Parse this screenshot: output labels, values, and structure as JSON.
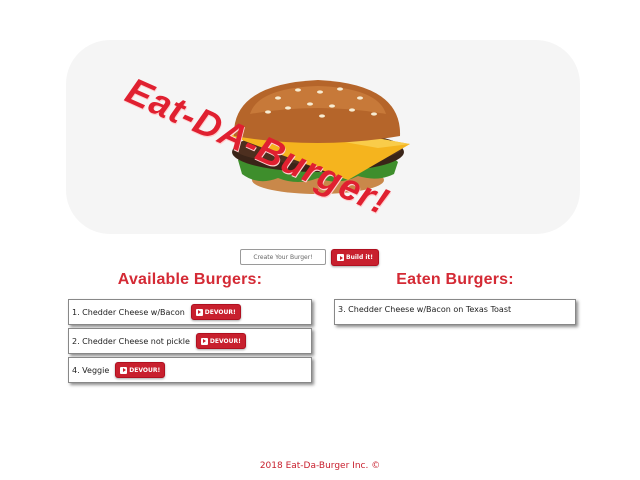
{
  "header": {
    "logo_text": "Eat-DA-Burger!"
  },
  "form": {
    "input_placeholder": "Create Your Burger!",
    "build_label": "Build it!"
  },
  "available": {
    "heading": "Available Burgers:",
    "items": [
      {
        "label": "1. Chedder Cheese w/Bacon",
        "button": "DEVOUR!"
      },
      {
        "label": "2. Chedder Cheese not pickle",
        "button": "DEVOUR!"
      },
      {
        "label": "4. Veggie",
        "button": "DEVOUR!"
      }
    ]
  },
  "eaten": {
    "heading": "Eaten Burgers:",
    "items": [
      {
        "label": "3. Chedder Cheese w/Bacon on Texas Toast"
      }
    ]
  },
  "footer": {
    "text": "2018 Eat-Da-Burger Inc. ©"
  },
  "colors": {
    "accent": "#c8202e",
    "heading": "#d42a35"
  },
  "icons": {
    "button_icon": "play-square-icon"
  }
}
